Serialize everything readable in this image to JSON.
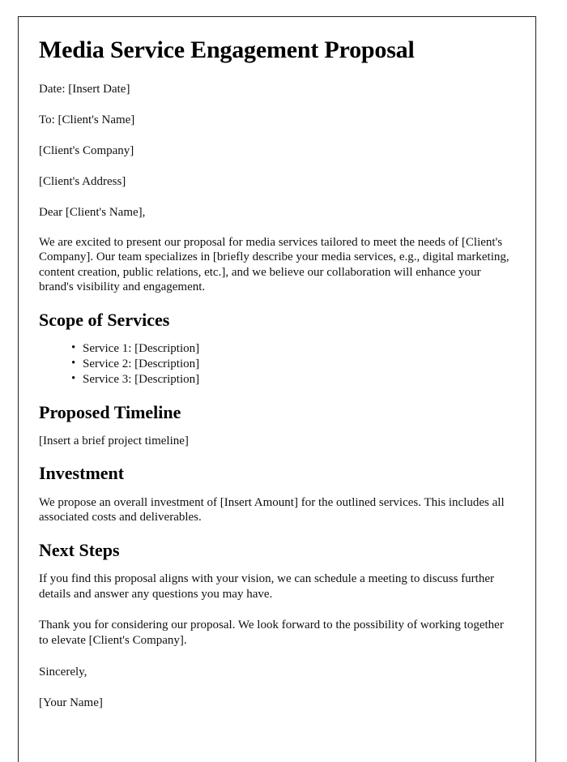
{
  "document": {
    "title": "Media Service Engagement Proposal",
    "meta": [
      {
        "id": "date",
        "text": "Date: [Insert Date]"
      },
      {
        "id": "recipient-name",
        "text": "To: [Client's Name]"
      },
      {
        "id": "recipient-company",
        "text": "[Client's Company]"
      },
      {
        "id": "recipient-address",
        "text": "[Client's Address]"
      }
    ],
    "salutation": "Dear [Client's Name],",
    "intro_paragraph": "We are excited to present our proposal for media services tailored to meet the needs of [Client's Company]. Our team specializes in [briefly describe your media services, e.g., digital marketing, content creation, public relations, etc.], and we believe our collaboration will enhance your brand's visibility and engagement.",
    "sections": [
      {
        "id": "scope-of-services",
        "heading": "Scope of Services",
        "items": [
          "Service 1: [Description]",
          "Service 2: [Description]",
          "Service 3: [Description]"
        ]
      },
      {
        "id": "proposed-timeline",
        "heading": "Proposed Timeline",
        "body": "[Insert a brief project timeline]"
      },
      {
        "id": "investment",
        "heading": "Investment",
        "body": "We propose an overall investment of [Insert Amount] for the outlined services. This includes all associated costs and deliverables."
      },
      {
        "id": "next-steps",
        "heading": "Next Steps",
        "body": "If you find this proposal aligns with your vision, we can schedule a meeting to discuss further details and answer any questions you may have."
      }
    ],
    "closing_paragraph": "Thank you for considering our proposal. We look forward to the possibility of working together to elevate [Client's Company].",
    "signoff": "Sincerely,",
    "signature_name": "[Your Name]"
  }
}
